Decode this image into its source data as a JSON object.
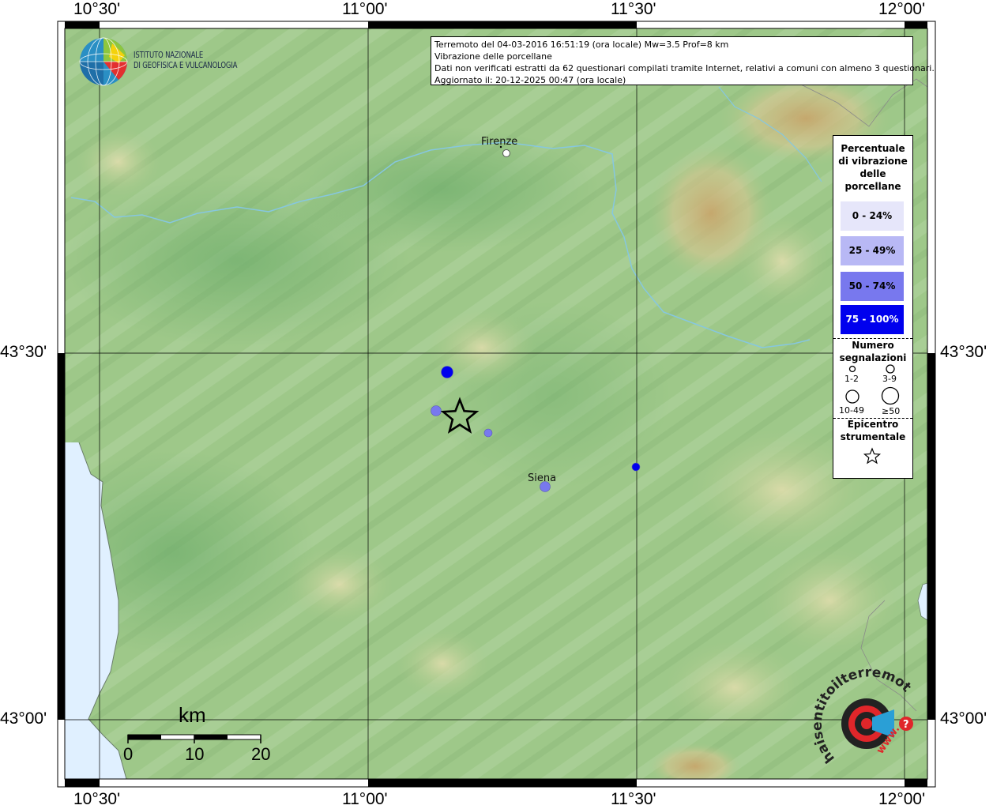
{
  "map": {
    "lon_labels": [
      "10°30'",
      "11°00'",
      "11°30'",
      "12°00'"
    ],
    "lat_labels": [
      "43°30'",
      "43°00'"
    ]
  },
  "info": {
    "line1": "Terremoto del 04-03-2016 16:51:19 (ora locale) Mw=3.5 Prof=8 km",
    "line2": "Vibrazione delle porcellane",
    "line3": "Dati non verificati estratti da 62 questionari compilati tramite Internet, relativi a comuni con almeno 3 questionari.",
    "line4": "Aggiornato il: 20-12-2025 00:47 (ora locale)"
  },
  "logo": {
    "line1": "ISTITUTO NAZIONALE",
    "line2": "DI GEOFISICA E VULCANOLOGIA"
  },
  "cities": {
    "firenze": "Firenze",
    "siena": "Siena"
  },
  "legend": {
    "title": [
      "Percentuale",
      "di vibrazione",
      "delle",
      "porcellane"
    ],
    "classes": [
      {
        "label": "0 - 24%",
        "color": "#e6e6fa",
        "text": "#000000"
      },
      {
        "label": "25 - 49%",
        "color": "#b8b8f5",
        "text": "#000000"
      },
      {
        "label": "50 - 74%",
        "color": "#7878ee",
        "text": "#000000"
      },
      {
        "label": "75 - 100%",
        "color": "#0000ee",
        "text": "#ffffff"
      }
    ],
    "count_title": [
      "Numero",
      "segnalazioni"
    ],
    "count_labels": [
      "1-2",
      "3-9",
      "10-49",
      "≥50"
    ],
    "epicentre_title": [
      "Epicentro",
      "strumentale"
    ]
  },
  "observations": [
    {
      "class": 3,
      "size": 3
    },
    {
      "class": 2,
      "size": 2
    },
    {
      "class": 2,
      "size": 1
    },
    {
      "class": 2,
      "size": 2
    },
    {
      "class": 3,
      "size": 1
    }
  ],
  "scale": {
    "unit": "km",
    "labels": [
      "0",
      "10",
      "20"
    ]
  },
  "haisentito": {
    "text": "haisentitoilterremoto.it",
    "url": "www."
  }
}
